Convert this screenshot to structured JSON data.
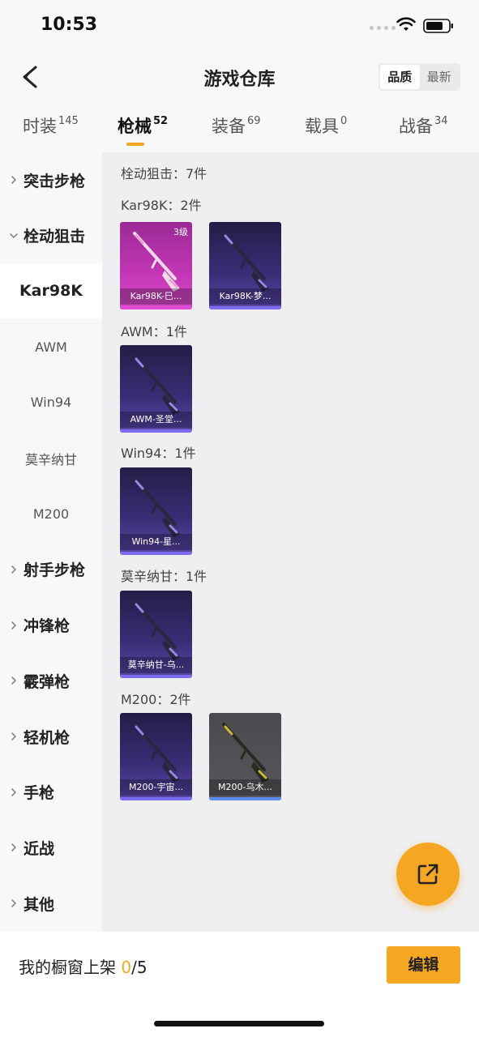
{
  "status_bar": {
    "time": "10:53"
  },
  "header": {
    "title": "游戏仓库",
    "sort_options": [
      "品质",
      "最新"
    ],
    "sort_active": "品质"
  },
  "tabs": [
    {
      "label": "时装",
      "count": "145"
    },
    {
      "label": "枪械",
      "count": "52",
      "active": true
    },
    {
      "label": "装备",
      "count": "69"
    },
    {
      "label": "载具",
      "count": "0"
    },
    {
      "label": "战备",
      "count": "34"
    }
  ],
  "sidebar": {
    "items": [
      {
        "label": "突击步枪",
        "type": "category"
      },
      {
        "label": "栓动狙击",
        "type": "category-open"
      },
      {
        "label": "Kar98K",
        "type": "selected"
      },
      {
        "label": "AWM",
        "type": "sub"
      },
      {
        "label": "Win94",
        "type": "sub"
      },
      {
        "label": "莫辛纳甘",
        "type": "sub"
      },
      {
        "label": "M200",
        "type": "sub"
      },
      {
        "label": "射手步枪",
        "type": "category"
      },
      {
        "label": "冲锋枪",
        "type": "category"
      },
      {
        "label": "霰弹枪",
        "type": "category"
      },
      {
        "label": "轻机枪",
        "type": "category"
      },
      {
        "label": "手枪",
        "type": "category"
      },
      {
        "label": "近战",
        "type": "category"
      },
      {
        "label": "其他",
        "type": "category"
      }
    ]
  },
  "content": {
    "summary": "栓动狙击：7件",
    "groups": [
      {
        "header": "Kar98K：2件",
        "cards": [
          {
            "caption": "Kar98K-巳...",
            "level": "3级",
            "theme": "pink",
            "bar_color": "#e44cd6"
          },
          {
            "caption": "Kar98K-梦...",
            "theme": "purple",
            "bar_color": "#7b6cf0"
          }
        ]
      },
      {
        "header": "AWM：1件",
        "cards": [
          {
            "caption": "AWM-圣堂...",
            "theme": "purple",
            "bar_color": "#7b6cf0"
          }
        ]
      },
      {
        "header": "Win94：1件",
        "cards": [
          {
            "caption": "Win94-星...",
            "theme": "purple",
            "bar_color": "#7b6cf0"
          }
        ]
      },
      {
        "header": "莫辛纳甘：1件",
        "cards": [
          {
            "caption": "莫辛纳甘-乌...",
            "theme": "purple",
            "bar_color": "#7b6cf0"
          }
        ]
      },
      {
        "header": "M200：2件",
        "cards": [
          {
            "caption": "M200-宇宙...",
            "theme": "purple",
            "bar_color": "#7b6cf0"
          },
          {
            "caption": "M200-乌木...",
            "theme": "gray",
            "bar_color": "#5b8cf0"
          }
        ]
      }
    ]
  },
  "bottom": {
    "shelf_label": "我的橱窗上架",
    "shelf_count": "0",
    "shelf_total": "/5",
    "edit_label": "编辑"
  },
  "colors": {
    "accent": "#f5a623"
  },
  "icons": {
    "back": "back-chevron-icon",
    "fab": "share-external-icon",
    "category": "chevron-right-icon",
    "open_category": "chevron-down-icon"
  }
}
